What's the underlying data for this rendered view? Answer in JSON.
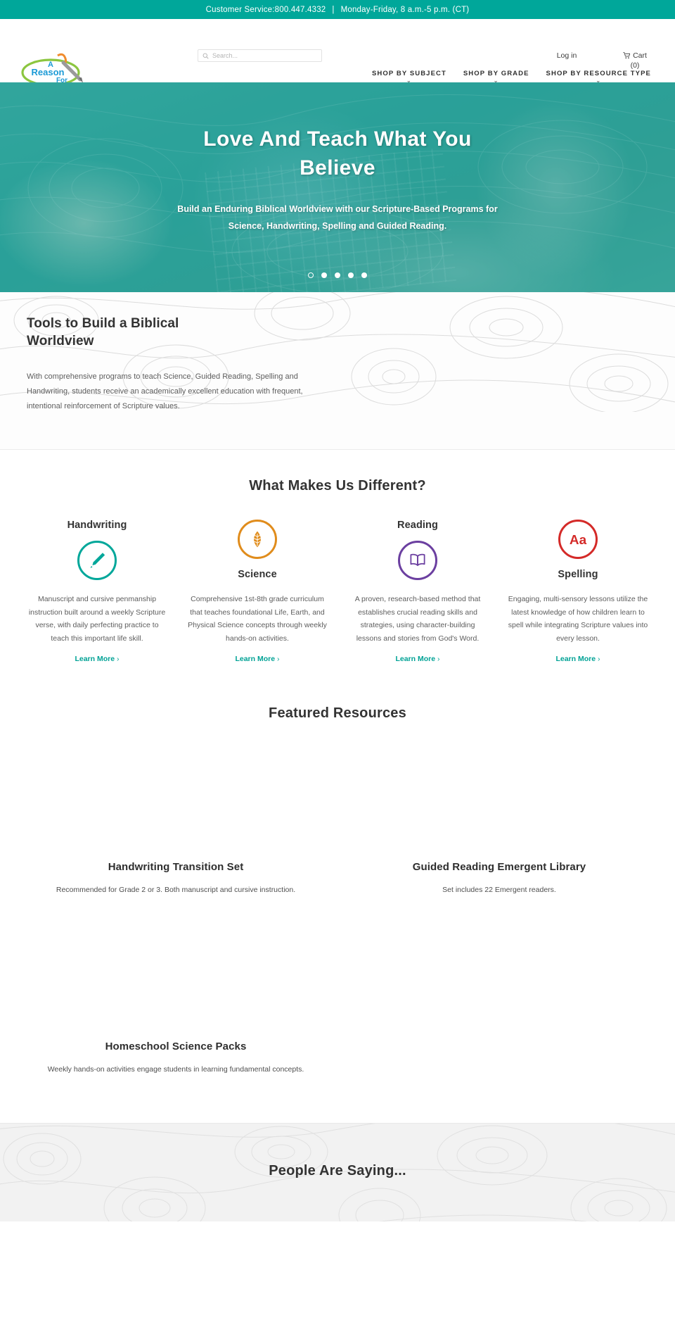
{
  "topbar": {
    "cs_label": "Customer Service:",
    "phone": "800.447.4332",
    "separator": "|",
    "hours": "Monday-Friday,  8 a.m.-5 p.m. (CT)"
  },
  "header": {
    "logo_line1": "A",
    "logo_line2": "Reason",
    "logo_line3": "For",
    "search": {
      "placeholder": "Search...",
      "value": ""
    },
    "login": "Log in",
    "cart_label": "Cart",
    "cart_count": "(0)",
    "nav": [
      {
        "label": "SHOP BY SUBJECT",
        "caret": "⌄"
      },
      {
        "label": "SHOP BY GRADE",
        "caret": "⌄"
      },
      {
        "label": "SHOP BY RESOURCE TYPE",
        "caret": "⌄"
      }
    ]
  },
  "hero": {
    "title": "Love And Teach What You Believe",
    "subtitle": "Build an Enduring Biblical Worldview with our Scripture-Based Programs for Science, Handwriting, Spelling and Guided Reading.",
    "slides": 5,
    "active_slide": 1
  },
  "tools": {
    "title": "Tools to Build a Biblical Worldview",
    "body": "With comprehensive programs to teach Science, Guided Reading, Spelling and Handwriting, students receive an academically excellent education with frequent, intentional reinforcement of Scripture values."
  },
  "different": {
    "title": "What Makes Us Different?",
    "learn_more": "Learn More",
    "chevron": "›",
    "columns": [
      {
        "title": "Handwriting",
        "icon": "pencil-icon",
        "color": "#00a79a",
        "layout": "title-first",
        "desc": "Manuscript and cursive penmanship instruction built around a weekly Scripture verse, with daily perfecting practice to teach this important life skill."
      },
      {
        "title": "Science",
        "icon": "leaf-icon",
        "color": "#e08c1c",
        "layout": "icon-first",
        "desc": "Comprehensive 1st-8th grade curriculum that teaches foundational Life, Earth, and Physical Science concepts through weekly hands-on activities."
      },
      {
        "title": "Reading",
        "icon": "open-book-icon",
        "color": "#6b3fa0",
        "layout": "title-first",
        "desc": "A proven, research-based method that establishes crucial reading skills and strategies, using character-building lessons and stories from God's Word."
      },
      {
        "title": "Spelling",
        "icon": "letters-aa-icon",
        "color": "#d42a28",
        "layout": "icon-first",
        "desc": "Engaging, multi-sensory lessons utilize the latest knowledge of how children learn to spell while integrating Scripture values into every lesson."
      }
    ]
  },
  "featured": {
    "title": "Featured Resources",
    "products": [
      {
        "title": "Handwriting Transition Set",
        "desc": "Recommended for Grade 2 or 3. Both manuscript and cursive instruction."
      },
      {
        "title": "Guided Reading Emergent Library",
        "desc": "Set includes 22 Emergent readers."
      },
      {
        "title": "Homeschool Science Packs",
        "desc": "Weekly hands-on activities engage students in learning fundamental concepts."
      }
    ]
  },
  "testimonials": {
    "title": "People Are Saying..."
  },
  "colors": {
    "brand_teal": "#00a79a",
    "hero_overlay": "#2fa199",
    "accent_link": "#00a295",
    "science_orange": "#e08c1c",
    "reading_purple": "#6b3fa0",
    "spelling_red": "#d42a28"
  }
}
